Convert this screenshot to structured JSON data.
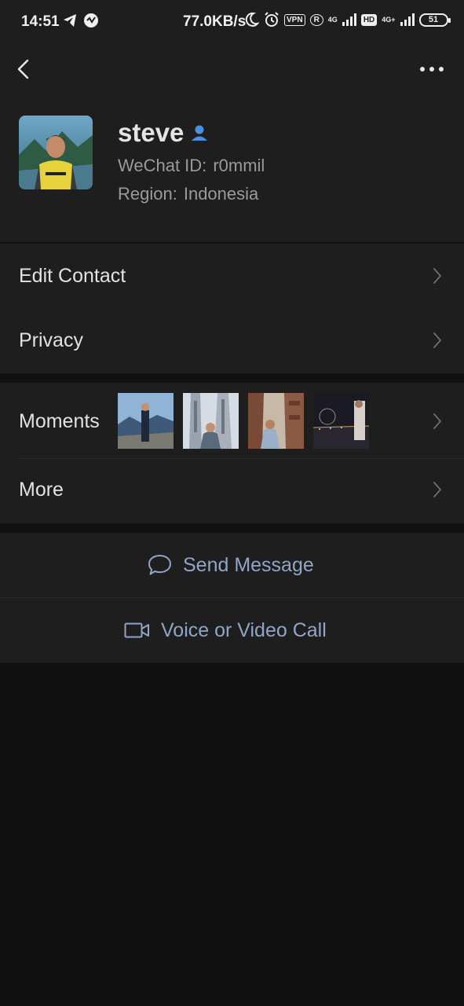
{
  "status_bar": {
    "time": "14:51",
    "net_speed": "77.0KB/s",
    "vpn": "VPN",
    "registered": "R",
    "net_4g_1": "4G",
    "hd": "HD",
    "net_4g_2": "4G+",
    "battery": "51",
    "icons": [
      "telegram-icon",
      "app-icon",
      "moon-icon",
      "alarm-icon",
      "signal-icon",
      "signal-icon"
    ]
  },
  "header": {
    "back_icon": "chevron-left-icon",
    "more_icon": "more-icon"
  },
  "profile": {
    "name": "steve",
    "wechat_id_label": "WeChat ID:",
    "wechat_id": "r0mmil",
    "region_label": "Region:",
    "region": "Indonesia",
    "contact_icon_color": "#4a90e2"
  },
  "list": {
    "edit_contact": "Edit Contact",
    "privacy": "Privacy",
    "moments": "Moments",
    "more": "More"
  },
  "actions": {
    "send_message": "Send Message",
    "call": "Voice or Video Call"
  },
  "colors": {
    "background": "#111111",
    "surface": "#1e1e1e",
    "accent_text": "#8fa6c6"
  }
}
